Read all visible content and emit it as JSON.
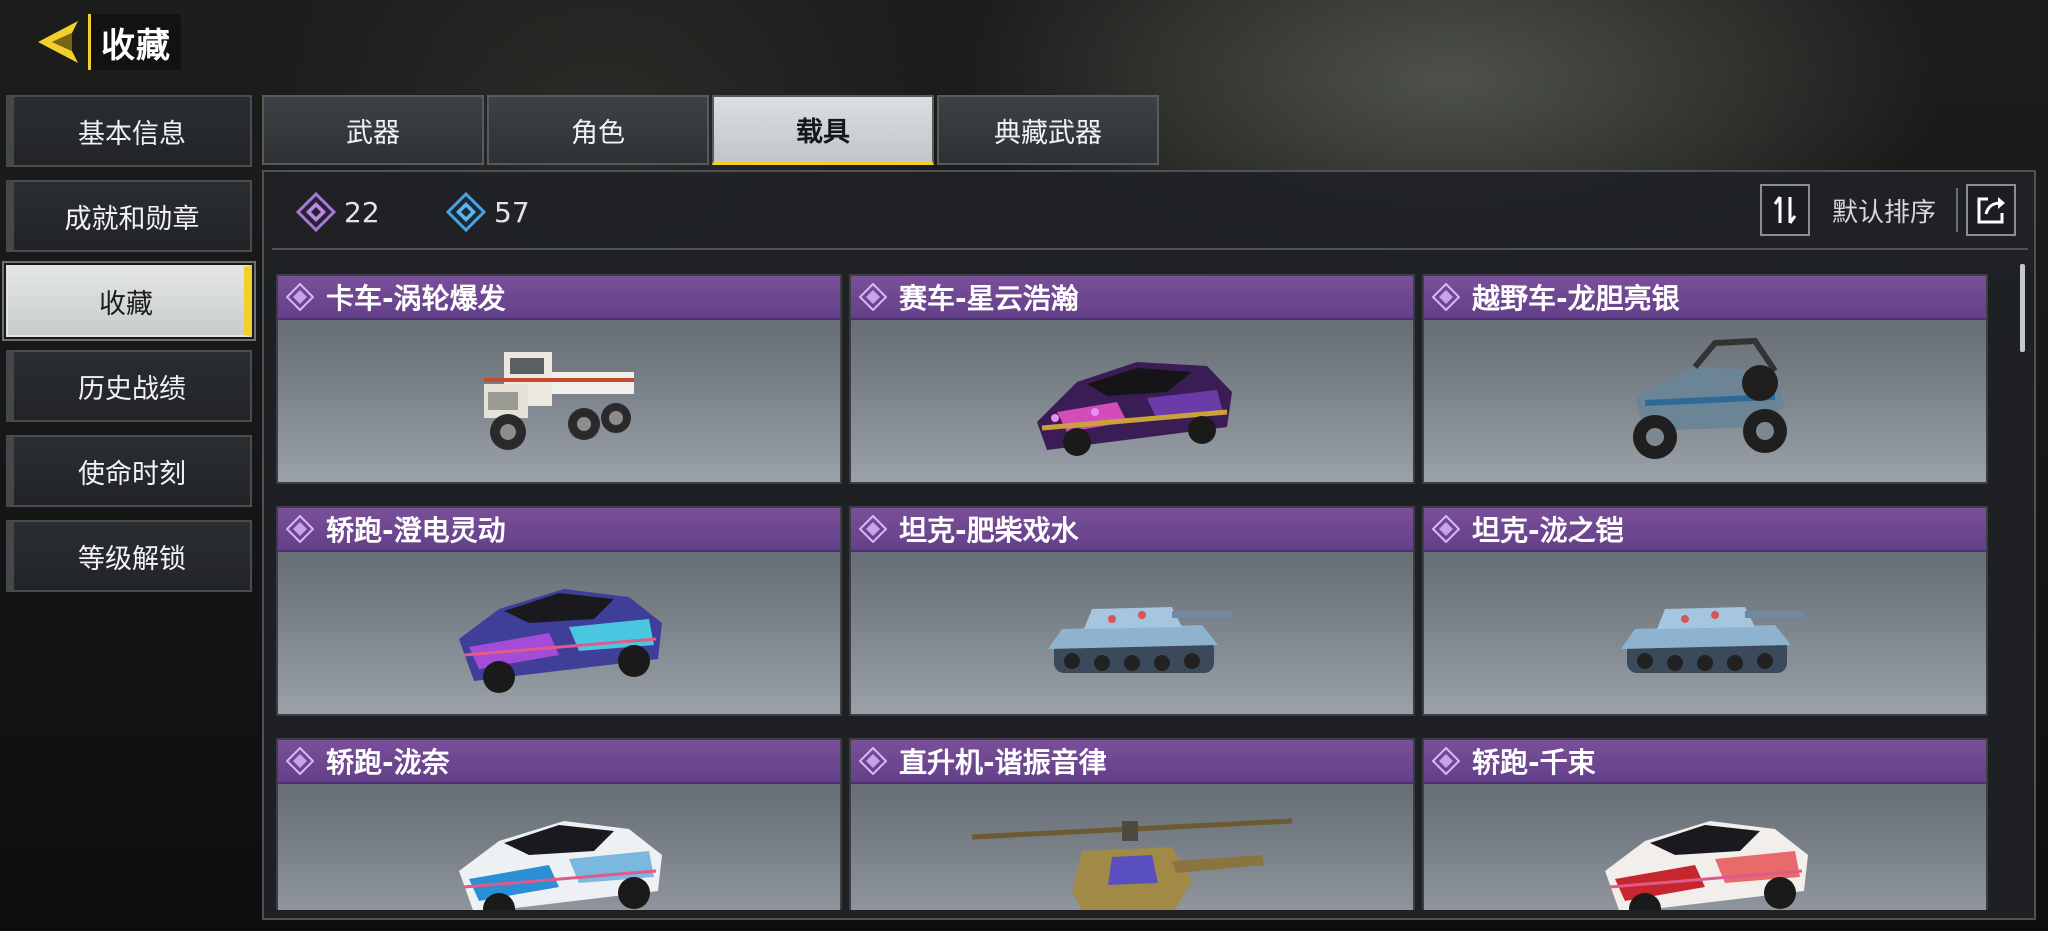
{
  "header": {
    "title": "收藏"
  },
  "sidebar": {
    "items": [
      {
        "label": "基本信息"
      },
      {
        "label": "成就和勋章"
      },
      {
        "label": "收藏"
      },
      {
        "label": "历史战绩"
      },
      {
        "label": "使命时刻"
      },
      {
        "label": "等级解锁"
      }
    ],
    "active_index": 2
  },
  "tabs": [
    {
      "label": "武器"
    },
    {
      "label": "角色"
    },
    {
      "label": "载具"
    },
    {
      "label": "典藏武器"
    }
  ],
  "active_tab_index": 2,
  "stats": {
    "purple_count": "22",
    "blue_count": "57"
  },
  "sort": {
    "label": "默认排序"
  },
  "colors": {
    "accent": "#f2cf2b",
    "epic_purple": "#6f4893",
    "rare_blue": "#4aa3e0"
  },
  "vehicles": [
    {
      "name": "卡车-涡轮爆发",
      "kind": "truck"
    },
    {
      "name": "赛车-星云浩瀚",
      "kind": "racer"
    },
    {
      "name": "越野车-龙胆亮银",
      "kind": "buggy"
    },
    {
      "name": "轿跑-澄电灵动",
      "kind": "coupe"
    },
    {
      "name": "坦克-肥柴戏水",
      "kind": "tank"
    },
    {
      "name": "坦克-泷之铠",
      "kind": "tank"
    },
    {
      "name": "轿跑-泷奈",
      "kind": "coupe"
    },
    {
      "name": "直升机-谐振音律",
      "kind": "helicopter"
    },
    {
      "name": "轿跑-千束",
      "kind": "coupe"
    }
  ]
}
